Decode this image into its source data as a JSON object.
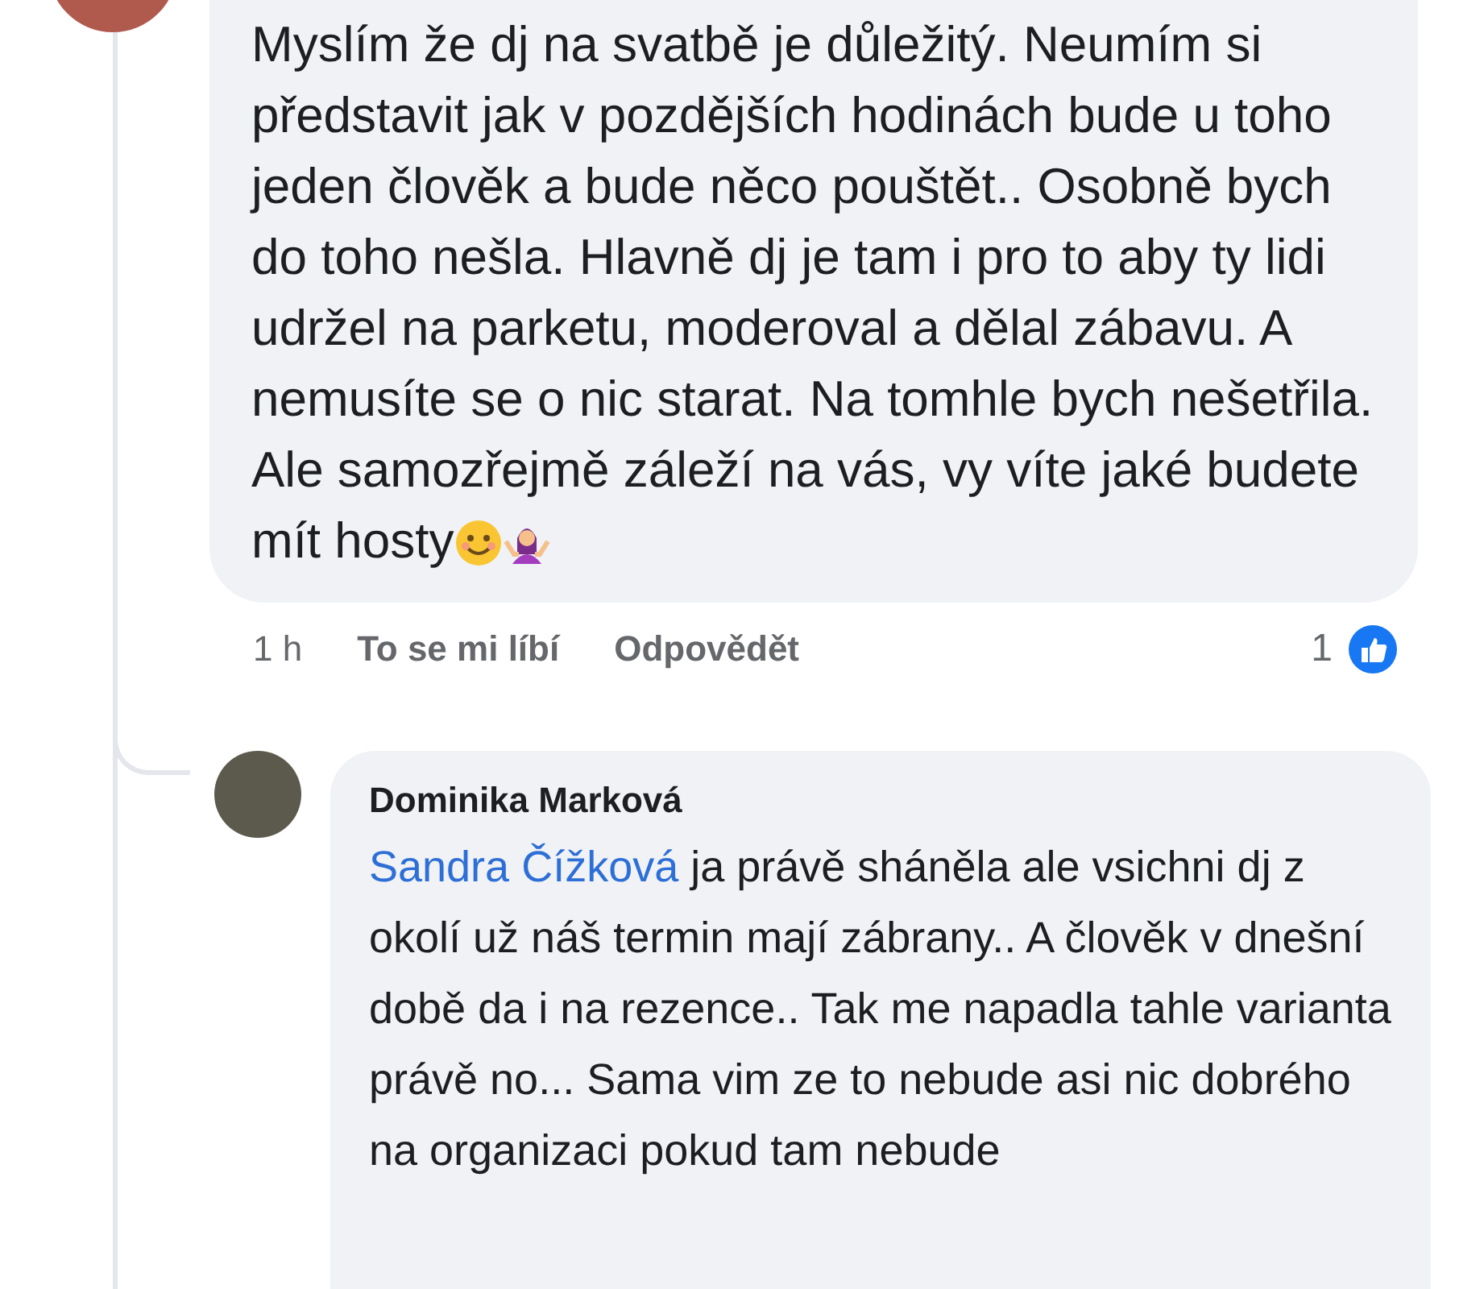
{
  "comment": {
    "text": "Myslím že dj na svatbě je důležitý. Neumím si představit jak v pozdějších hodinách bude u toho jeden člověk a bude něco pouštět.. Osobně bych do toho nešla. Hlavně dj je tam i pro to aby ty lidi udržel na parketu, moderoval a dělal zábavu. A nemusíte se o nic starat. Na tomhle bych nešetřila. Ale samozřejmě záleží na vás, vy víte jaké budete mít hosty",
    "time": "1 h",
    "like_label": "To se mi líbí",
    "reply_label": "Odpovědět",
    "reaction_count": "1"
  },
  "reply": {
    "author": "Dominika Marková",
    "mention": "Sandra Čížková",
    "text": " ja právě sháněla ale vsichni dj z okolí už náš termin mají zábrany.. A člověk v dnešní době da i na rezence.. Tak me napadla tahle varianta právě no... Sama vim ze to nebude asi nic dobrého na organizaci pokud tam nebude"
  }
}
